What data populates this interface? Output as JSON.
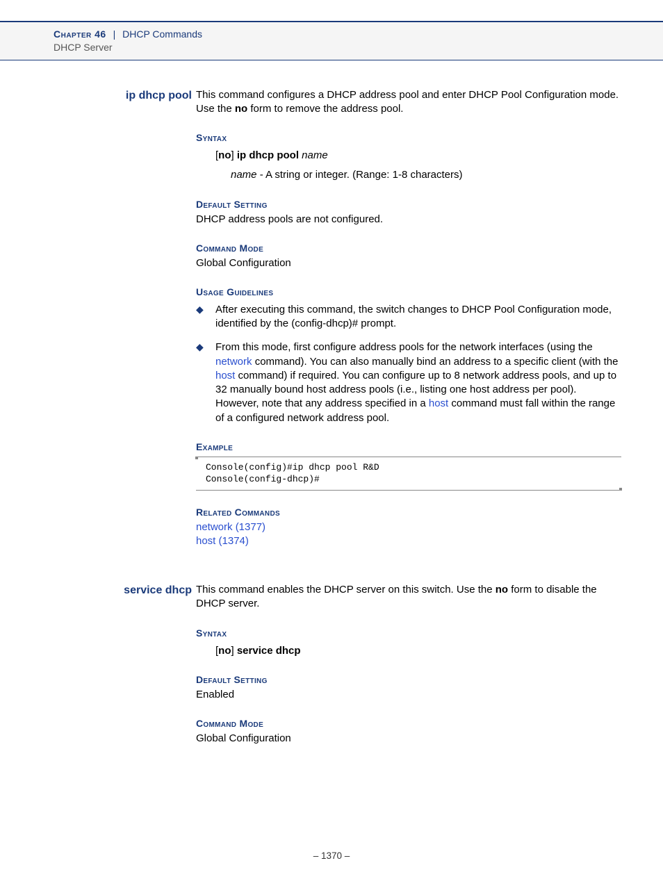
{
  "header": {
    "chapter": "Chapter 46",
    "separator": "|",
    "title": "DHCP Commands",
    "subtitle": "DHCP Server"
  },
  "commands": [
    {
      "name": "ip dhcp pool",
      "desc_pre": "This command configures a DHCP address pool and enter DHCP Pool Configuration mode. Use the ",
      "desc_bold": "no",
      "desc_post": " form to remove the address pool.",
      "syntax_heading": "Syntax",
      "syntax_no": "no",
      "syntax_cmd": "ip dhcp pool",
      "syntax_param": "name",
      "param_name": "name",
      "param_desc": " - A string or integer. (Range: 1-8 characters)",
      "default_heading": "Default Setting",
      "default_text": "DHCP address pools are not configured.",
      "mode_heading": "Command Mode",
      "mode_text": "Global Configuration",
      "usage_heading": "Usage Guidelines",
      "bullet1": "After executing this command, the switch changes to DHCP Pool Configuration mode, identified by the (config-dhcp)# prompt.",
      "bullet2_a": "From this mode, first configure address pools for the network interfaces (using the ",
      "bullet2_link1": "network",
      "bullet2_b": " command). You can also manually bind an address to a specific client (with the ",
      "bullet2_link2": "host",
      "bullet2_c": " command) if required. You can configure up to 8 network address pools, and up to 32 manually bound host address pools (i.e., listing one host address per pool). However, note that any address specified in a ",
      "bullet2_link3": "host",
      "bullet2_d": " command must fall within the range of a configured network address pool.",
      "example_heading": "Example",
      "example_code": "Console(config)#ip dhcp pool R&D\nConsole(config-dhcp)#",
      "related_heading": "Related Commands",
      "related1": "network (1377)",
      "related2": "host (1374)"
    },
    {
      "name": "service dhcp",
      "desc_pre": "This command enables the DHCP server on this switch. Use the ",
      "desc_bold": "no",
      "desc_post": " form to disable the DHCP server.",
      "syntax_heading": "Syntax",
      "syntax_no": "no",
      "syntax_cmd": "service dhcp",
      "default_heading": "Default Setting",
      "default_text": "Enabled",
      "mode_heading": "Command Mode",
      "mode_text": "Global Configuration"
    }
  ],
  "page_number": "–  1370  –"
}
